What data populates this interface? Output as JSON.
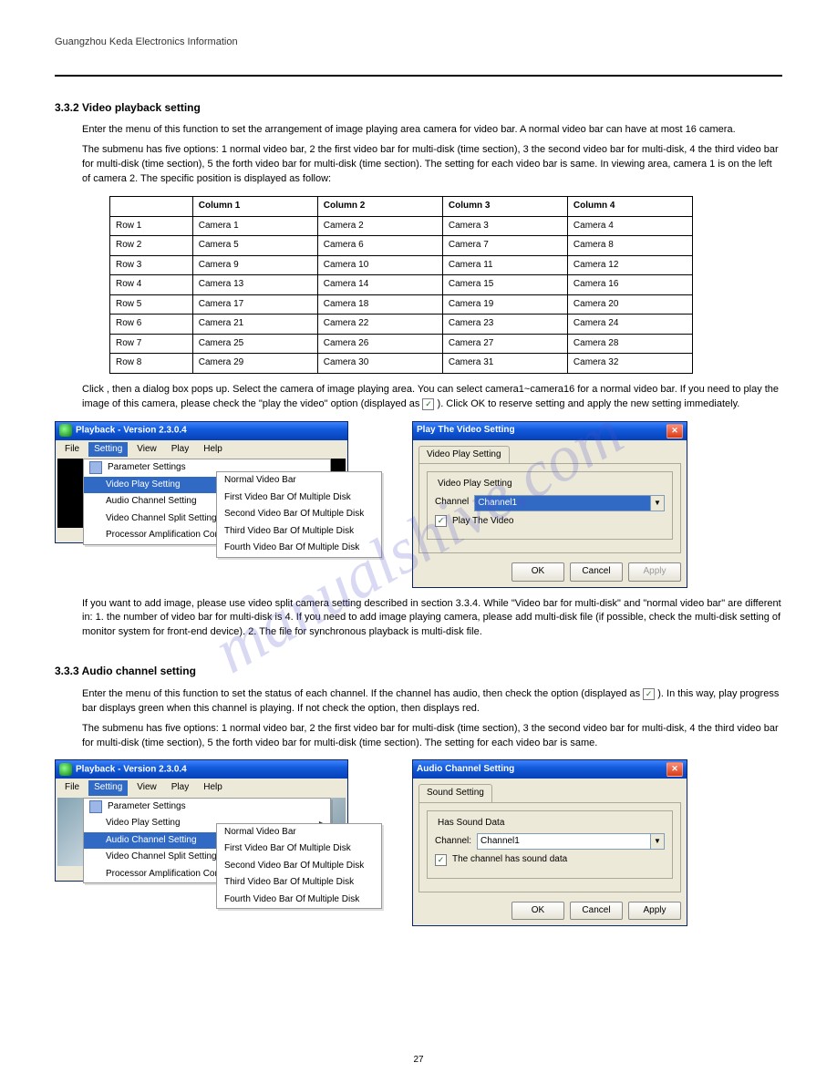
{
  "header_caption": "Guangzhou Keda Electronics Information",
  "sections": {
    "s332": {
      "title": "3.3.2 Video playback setting",
      "p1": "Enter the menu of this function to set the arrangement of image playing area camera for video bar. A normal video bar can have at most 16 camera.",
      "p2": "The submenu has five options: 1 normal video bar, 2 the first video bar for multi-disk (time section), 3 the second video bar for multi-disk, 4 the third video bar for multi-disk (time section), 5 the forth video bar for multi-disk (time section). The setting for each video bar is same. In viewing area, camera 1 is on the left of camera 2. The specific position is displayed as follow:",
      "table": {
        "cols": [
          "",
          "Column 1",
          "Column 2",
          "Column 3",
          "Column 4"
        ],
        "rows": [
          [
            "Row 1",
            "Camera 1",
            "Camera 2",
            "Camera 3",
            "Camera 4"
          ],
          [
            "Row 2",
            "Camera 5",
            "Camera 6",
            "Camera 7",
            "Camera 8"
          ],
          [
            "Row 3",
            "Camera 9",
            "Camera 10",
            "Camera 11",
            "Camera 12"
          ],
          [
            "Row 4",
            "Camera 13",
            "Camera 14",
            "Camera 15",
            "Camera 16"
          ],
          [
            "Row 5",
            "Camera 17",
            "Camera 18",
            "Camera 19",
            "Camera 20"
          ],
          [
            "Row 6",
            "Camera 21",
            "Camera 22",
            "Camera 23",
            "Camera 24"
          ],
          [
            "Row 7",
            "Camera 25",
            "Camera 26",
            "Camera 27",
            "Camera 28"
          ],
          [
            "Row 8",
            "Camera 29",
            "Camera 30",
            "Camera 31",
            "Camera 32"
          ]
        ]
      },
      "p3a_prefix": "Click ",
      "p3a_mid": ", then a dialog box pops up. Select the camera of image playing area. You can select camera1~camera16 for a normal video bar. If you need to play the image of this camera, please check the \"play the video\" option (displayed as ",
      "p3a_suffix": "). Click OK to reserve setting and apply the new setting immediately.",
      "p4": "If you want to add image, please use video split camera setting described in section 3.3.4. While \"Video bar for multi-disk\" and \"normal video bar\" are different in: 1. the number of video bar for multi-disk is 4. If you need to add image playing camera, please add multi-disk file (if possible, check the multi-disk setting of monitor system for front-end device). 2. The file for synchronous playback is multi-disk file."
    },
    "s333": {
      "title": "3.3.3 Audio channel setting",
      "p1_prefix": "Enter the menu of this function to set the status of each channel. If the channel has audio, then check the option (displayed as ",
      "p1_mid": "). In this way, play progress bar displays green when this channel is playing. If not check the option, then displays red.",
      "p2": "The submenu has five options: 1 normal video bar, 2 the first video bar for multi-disk (time section), 3 the second video bar for multi-disk, 4 the third video bar for multi-disk (time section), 5 the forth video bar for multi-disk (time section). The setting for each video bar is same."
    }
  },
  "app_window": {
    "title": "Playback - Version 2.3.0.4",
    "menus": [
      "File",
      "Setting",
      "View",
      "Play",
      "Help"
    ],
    "active_menu": 1,
    "dropdown_a": {
      "items": [
        {
          "label": "Parameter Settings",
          "icon": true
        },
        {
          "label": "Video Play Setting",
          "sub": true,
          "hl": true
        },
        {
          "label": "Audio Channel Setting",
          "sub": true
        },
        {
          "label": "Video Channel Split Setting"
        },
        {
          "label": "Processor Amplification Control"
        }
      ],
      "submenu": [
        "Normal Video Bar",
        "First Video Bar Of Multiple Disk",
        "Second Video Bar Of Multiple Disk",
        "Third Video Bar Of Multiple Disk",
        "Fourth Video Bar Of Multiple Disk"
      ]
    },
    "dropdown_b": {
      "items": [
        {
          "label": "Parameter Settings",
          "icon": true
        },
        {
          "label": "Video Play Setting",
          "sub": true
        },
        {
          "label": "Audio Channel Setting",
          "sub": true,
          "hl": true
        },
        {
          "label": "Video Channel Split Setting"
        },
        {
          "label": "Processor Amplification Control"
        }
      ],
      "submenu": [
        "Normal Video Bar",
        "First Video Bar Of Multiple Disk",
        "Second Video Bar Of Multiple Disk",
        "Third Video Bar Of Multiple Disk",
        "Fourth Video Bar Of Multiple Disk"
      ]
    }
  },
  "dialog_video": {
    "title": "Play The Video Setting",
    "tab": "Video Play Setting",
    "fieldset": "Video Play Setting",
    "label_channel": "Channel",
    "channel_value": "Channel1",
    "check_label": "Play The Video",
    "btn_ok": "OK",
    "btn_cancel": "Cancel",
    "btn_apply": "Apply"
  },
  "dialog_audio": {
    "title": "Audio Channel Setting",
    "tab": "Sound Setting",
    "fieldset": "Has Sound Data",
    "label_channel": "Channel:",
    "channel_value": "Channel1",
    "check_label": "The channel has sound data",
    "btn_ok": "OK",
    "btn_cancel": "Cancel",
    "btn_apply": "Apply"
  },
  "page_number": "27",
  "watermark": "manualshive.com"
}
